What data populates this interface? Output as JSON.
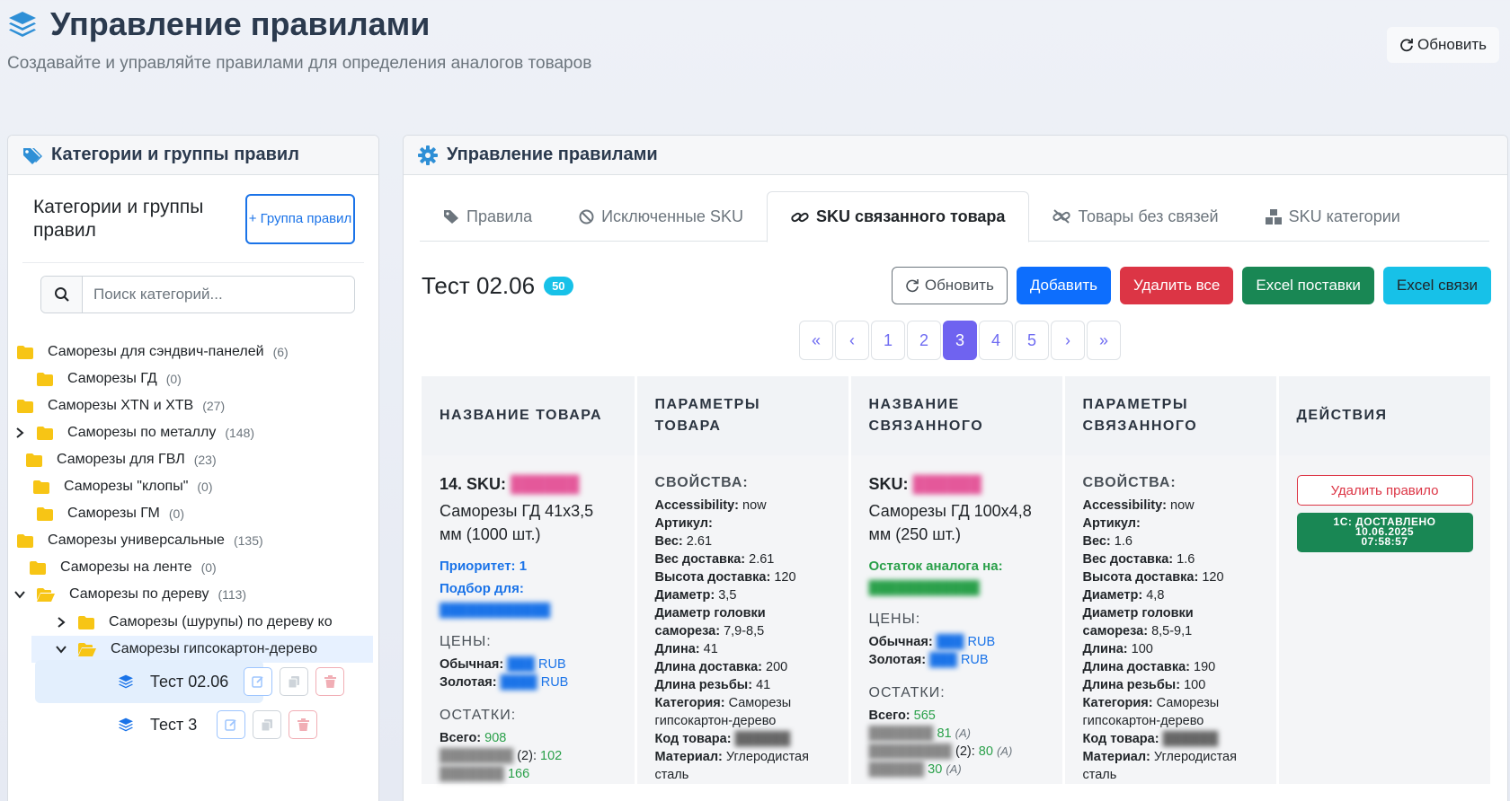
{
  "header": {
    "title": "Управление правилами",
    "subtitle": "Создавайте и управляйте правилами для определения аналогов товаров",
    "refresh_label": "Обновить"
  },
  "left": {
    "card_title": "Категории и группы правил",
    "section_title": "Категории и группы правил",
    "add_group_label": "+ Группа правил",
    "search_placeholder": "Поиск категорий...",
    "tree": [
      {
        "label": "Саморезы для сэндвич-панелей",
        "count": "(6)"
      },
      {
        "label": "Саморезы ГД",
        "count": "(0)"
      },
      {
        "label": "Саморезы XTN и XTB",
        "count": "(27)"
      },
      {
        "label": "Саморезы по металлу",
        "count": "(148)"
      },
      {
        "label": "Саморезы для ГВЛ",
        "count": "(23)"
      },
      {
        "label": "Саморезы \"клопы\"",
        "count": "(0)"
      },
      {
        "label": "Саморезы ГМ",
        "count": "(0)"
      },
      {
        "label": "Саморезы универсальные",
        "count": "(135)"
      },
      {
        "label": "Саморезы на ленте",
        "count": "(0)"
      },
      {
        "label": "Саморезы по дереву",
        "count": "(113)"
      },
      {
        "label": "Саморезы (шурупы) по дереву ко"
      },
      {
        "label": "Саморезы гипсокартон-дерево"
      }
    ],
    "groups": [
      {
        "label": "Тест 02.06"
      },
      {
        "label": "Тест 3"
      }
    ]
  },
  "right": {
    "card_title": "Управление правилами",
    "tabs": [
      {
        "label": "Правила",
        "icon": "tag-icon"
      },
      {
        "label": "Исключенные SKU",
        "icon": "ban-icon"
      },
      {
        "label": "SKU связанного товара",
        "icon": "link-icon"
      },
      {
        "label": "Товары без связей",
        "icon": "unlink-icon"
      },
      {
        "label": "SKU категории",
        "icon": "boxes-icon"
      }
    ],
    "section": {
      "title": "Тест 02.06",
      "badge": "50"
    },
    "actions": {
      "refresh": "Обновить",
      "add": "Добавить",
      "delete_all": "Удалить все",
      "excel_supply": "Excel поставки",
      "excel_links": "Excel связи"
    },
    "pagination": [
      "«",
      "‹",
      "1",
      "2",
      "3",
      "4",
      "5",
      "›",
      "»"
    ],
    "pagination_active": "3",
    "columns": [
      "НАЗВАНИЕ ТОВАРА",
      "ПАРАМЕТРЫ ТОВАРА",
      "НАЗВАНИЕ СВЯЗАННОГО",
      "ПАРАМЕТРЫ СВЯЗАННОГО",
      "ДЕЙСТВИЯ"
    ],
    "row": {
      "product": {
        "index": "14. SKU:",
        "name": "Саморезы ГД 41х3,5 мм (1000 шт.)",
        "priority": "Приоритет: 1",
        "selection_for": "Подбор для:",
        "prices_head": "ЦЕНЫ:",
        "price_regular_label": "Обычная:",
        "price_gold_label": "Золотая:",
        "currency": "RUB",
        "stock_head": "ОСТАТКИ:",
        "stock_total_label": "Всего:",
        "stock_total": "908",
        "stock_1_qty": "102",
        "stock_1_suffix": "(2):",
        "stock_2_qty": "166"
      },
      "product_params": {
        "head": "СВОЙСТВА:",
        "items": [
          {
            "k": "Accessibility:",
            "v": "now"
          },
          {
            "k": "Артикул:",
            "v": ""
          },
          {
            "k": "Вес:",
            "v": "2.61"
          },
          {
            "k": "Вес доставка:",
            "v": "2.61"
          },
          {
            "k": "Высота доставка:",
            "v": "120"
          },
          {
            "k": "Диаметр:",
            "v": "3,5"
          },
          {
            "k": "Диаметр головки самореза:",
            "v": "7,9-8,5"
          },
          {
            "k": "Длина:",
            "v": "41"
          },
          {
            "k": "Длина доставка:",
            "v": "200"
          },
          {
            "k": "Длина резьбы:",
            "v": "41"
          },
          {
            "k": "Категория:",
            "v": "Саморезы гипсокартон-дерево"
          },
          {
            "k": "Код товара:",
            "v": ""
          },
          {
            "k": "Материал:",
            "v": "Углеродистая сталь"
          }
        ]
      },
      "linked": {
        "sku_label": "SKU:",
        "name": "Саморезы ГД 100х4,8 мм (250 шт.)",
        "stock_label": "Остаток аналога на:",
        "prices_head": "ЦЕНЫ:",
        "price_regular_label": "Обычная:",
        "price_gold_label": "Золотая:",
        "currency": "RUB",
        "stock_head": "ОСТАТКИ:",
        "stock_total_label": "Всего:",
        "stock_total": "565",
        "stock_1_qty": "81",
        "stock_2_suffix": "(2):",
        "stock_2_qty": "80",
        "stock_3_qty": "30",
        "stock_flag": "(A)"
      },
      "linked_params": {
        "head": "СВОЙСТВА:",
        "items": [
          {
            "k": "Accessibility:",
            "v": "now"
          },
          {
            "k": "Артикул:",
            "v": ""
          },
          {
            "k": "Вес:",
            "v": "1.6"
          },
          {
            "k": "Вес доставка:",
            "v": "1.6"
          },
          {
            "k": "Высота доставка:",
            "v": "120"
          },
          {
            "k": "Диаметр:",
            "v": "4,8"
          },
          {
            "k": "Диаметр головки самореза:",
            "v": "8,5-9,1"
          },
          {
            "k": "Длина:",
            "v": "100"
          },
          {
            "k": "Длина доставка:",
            "v": "190"
          },
          {
            "k": "Длина резьбы:",
            "v": "100"
          },
          {
            "k": "Категория:",
            "v": "Саморезы гипсокартон-дерево"
          },
          {
            "k": "Код товара:",
            "v": ""
          },
          {
            "k": "Материал:",
            "v": "Углеродистая сталь"
          }
        ]
      },
      "actions": {
        "delete_rule": "Удалить правило",
        "status_line1": "1С: ДОСТАВЛЕНО",
        "status_line2": "10.06.2025",
        "status_line3": "07:58:57"
      }
    }
  }
}
